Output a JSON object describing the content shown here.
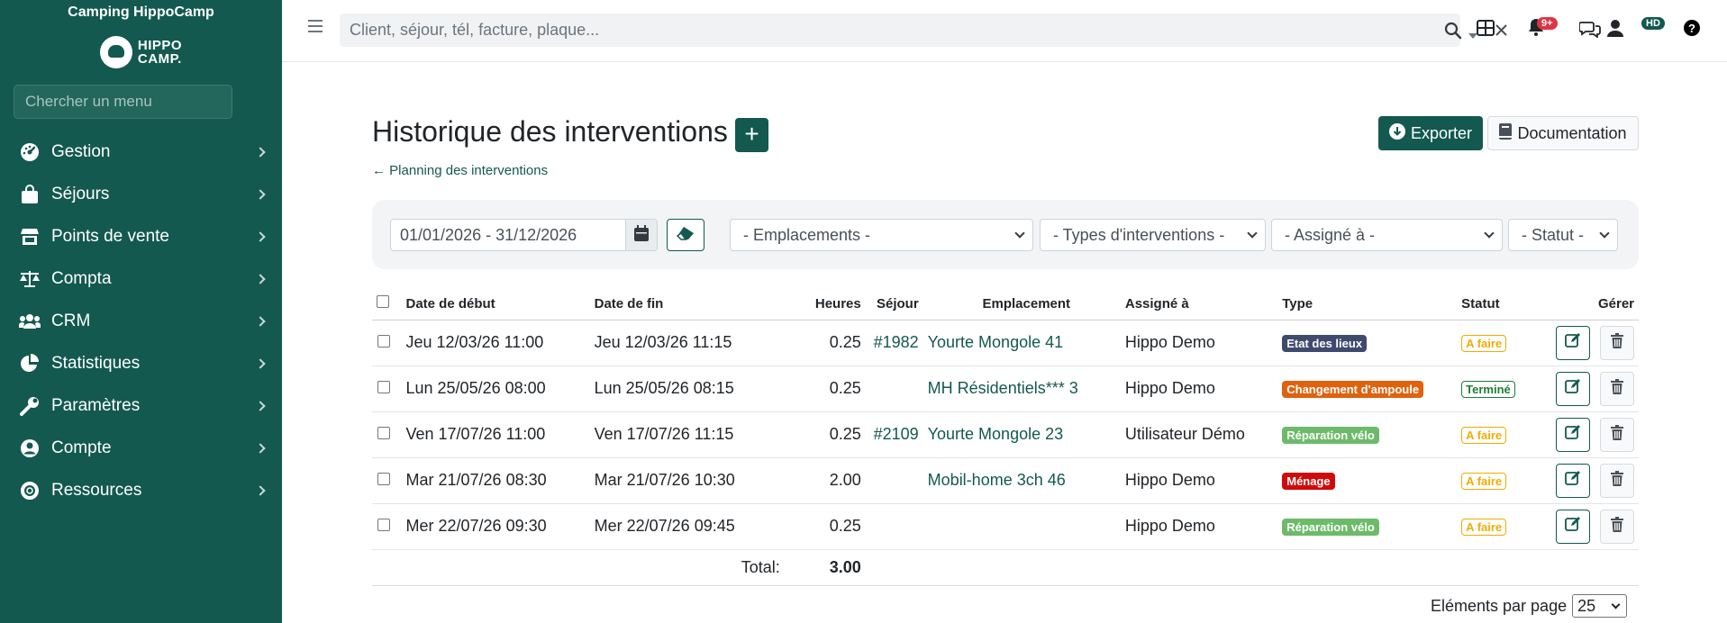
{
  "sidebar": {
    "camp_name": "Camping HippoCamp",
    "logo_line1": "HIPPO",
    "logo_line2": "CAMP.",
    "search_placeholder": "Chercher un menu",
    "items": [
      {
        "label": "Gestion",
        "icon": "gauge-icon"
      },
      {
        "label": "Séjours",
        "icon": "bag-icon"
      },
      {
        "label": "Points de vente",
        "icon": "store-icon"
      },
      {
        "label": "Compta",
        "icon": "scale-icon"
      },
      {
        "label": "CRM",
        "icon": "users-icon"
      },
      {
        "label": "Statistiques",
        "icon": "pie-chart-icon"
      },
      {
        "label": "Paramètres",
        "icon": "wrench-icon"
      },
      {
        "label": "Compte",
        "icon": "user-circle-icon"
      },
      {
        "label": "Ressources",
        "icon": "lifebuoy-icon"
      }
    ]
  },
  "topbar": {
    "search_placeholder": "Client, séjour, tél, facture, plaque...",
    "notifications_badge": "9+",
    "user_initials": "HD"
  },
  "page": {
    "title": "Historique des interventions",
    "back_link": "Planning des interventions",
    "export_label": "Exporter",
    "doc_label": "Documentation"
  },
  "filters": {
    "date_range": "01/01/2026 - 31/12/2026",
    "emplacements": "- Emplacements -",
    "types": "- Types d'interventions -",
    "assigne": "- Assigné à -",
    "statut": "- Statut -"
  },
  "table": {
    "headers": {
      "debut": "Date de début",
      "fin": "Date de fin",
      "heures": "Heures",
      "sejour": "Séjour",
      "emplacement": "Emplacement",
      "assigne": "Assigné à",
      "type": "Type",
      "statut": "Statut",
      "gerer": "Gérer"
    },
    "rows": [
      {
        "debut": "Jeu 12/03/26 11:00",
        "fin": "Jeu 12/03/26 11:15",
        "heures": "0.25",
        "sejour": "#1982",
        "emplacement": "Yourte Mongole 41",
        "assigne": "Hippo Demo",
        "type": "Etat des lieux",
        "type_color": "#3f4a6e",
        "statut": "A faire",
        "statut_color": "#f0ad00"
      },
      {
        "debut": "Lun 25/05/26 08:00",
        "fin": "Lun 25/05/26 08:15",
        "heures": "0.25",
        "sejour": "",
        "emplacement": "MH Résidentiels*** 3",
        "assigne": "Hippo Demo",
        "type": "Changement d'ampoule",
        "type_color": "#e0620e",
        "statut": "Terminé",
        "statut_color": "#1e7e34"
      },
      {
        "debut": "Ven 17/07/26 11:00",
        "fin": "Ven 17/07/26 11:15",
        "heures": "0.25",
        "sejour": "#2109",
        "emplacement": "Yourte Mongole 23",
        "assigne": "Utilisateur Démo",
        "type": "Réparation vélo",
        "type_color": "#6dbb6a",
        "statut": "A faire",
        "statut_color": "#f0ad00"
      },
      {
        "debut": "Mar 21/07/26 08:30",
        "fin": "Mar 21/07/26 10:30",
        "heures": "2.00",
        "sejour": "",
        "emplacement": "Mobil-home 3ch 46",
        "assigne": "Hippo Demo",
        "type": "Ménage",
        "type_color": "#d10a0a",
        "statut": "A faire",
        "statut_color": "#f0ad00"
      },
      {
        "debut": "Mer 22/07/26 09:30",
        "fin": "Mer 22/07/26 09:45",
        "heures": "0.25",
        "sejour": "",
        "emplacement": "",
        "assigne": "Hippo Demo",
        "type": "Réparation vélo",
        "type_color": "#6dbb6a",
        "statut": "A faire",
        "statut_color": "#f0ad00"
      }
    ],
    "total_label": "Total:",
    "total_value": "3.00"
  },
  "pagination": {
    "per_page_label": "Eléments par page",
    "per_page_value": "25"
  },
  "colors": {
    "brand": "#13594f",
    "danger": "#dc3545"
  }
}
